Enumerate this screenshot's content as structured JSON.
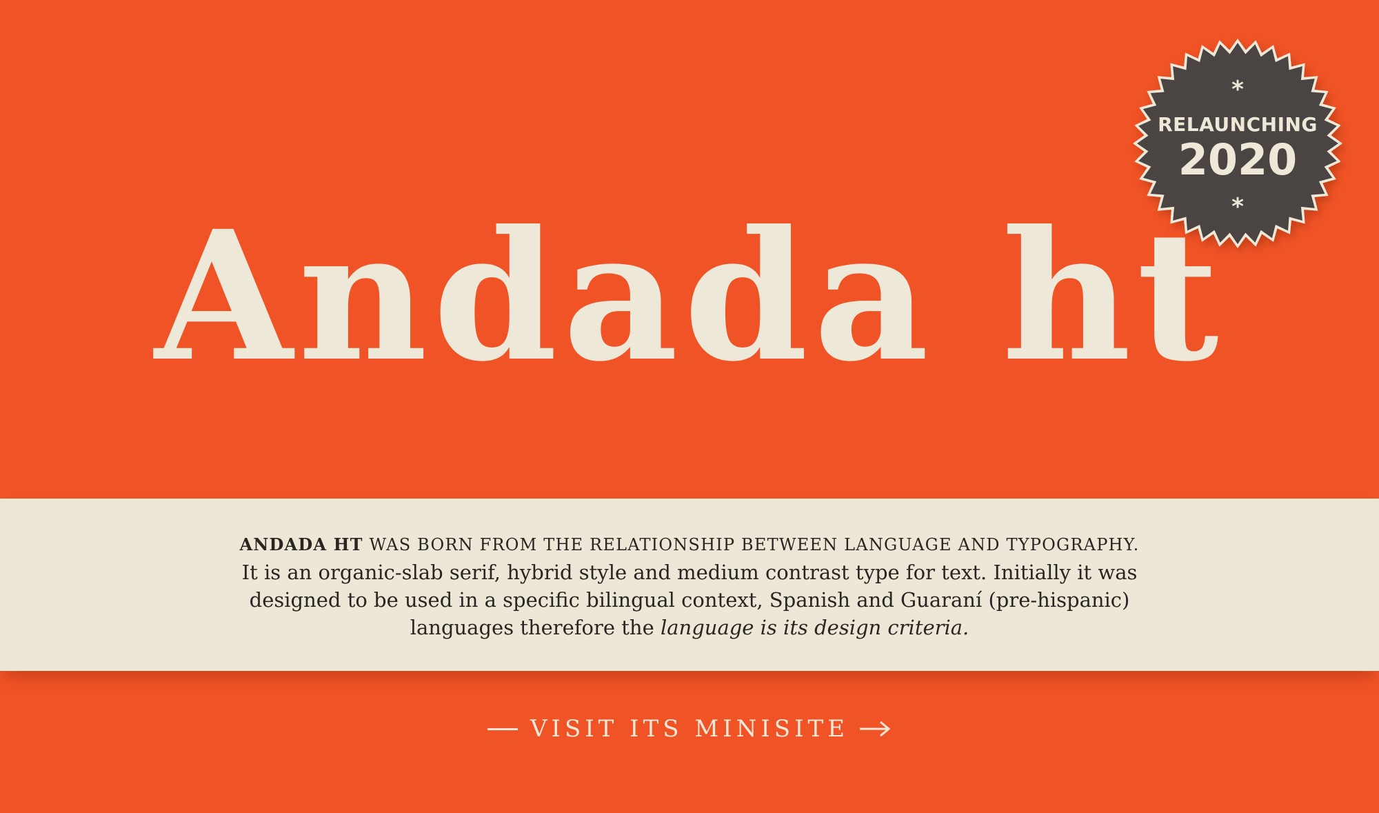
{
  "hero": {
    "title": "Andada ht",
    "background_color": "#F05325",
    "text_color": "#EDE8D8"
  },
  "badge": {
    "star_top": "*",
    "label": "RELAUNCHING",
    "year": "2020",
    "star_bottom": "*",
    "color": "#4A4542",
    "icon": "starburst-badge"
  },
  "description": {
    "lead_strong": "ANDADA HT",
    "lead_rest": " WAS BORN FROM THE RELATIONSHIP BETWEEN LANGUAGE AND TYPOGRAPHY.",
    "line1": "It is an organic-slab serif, hybrid style and medium contrast type for text. Initially it was",
    "line2": "designed to be used in a specific bilingual context, Spanish and Guaraní (pre-hispanic)",
    "line3_plain": "languages therefore the ",
    "line3_italic": "language is its design criteria.",
    "background_color": "#ECE7D6"
  },
  "cta": {
    "label": "VISIT ITS MINISITE",
    "icon_left": "dash-icon",
    "icon_right": "arrow-right-icon"
  }
}
